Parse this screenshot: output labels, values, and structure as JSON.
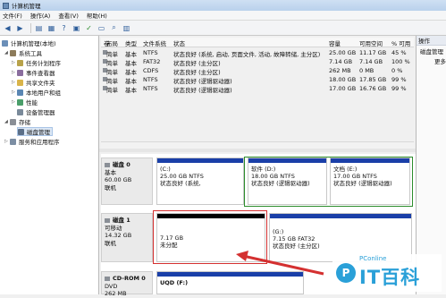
{
  "window": {
    "title": "计算机管理"
  },
  "menu": [
    "文件(F)",
    "操作(A)",
    "查看(V)",
    "帮助(H)"
  ],
  "toolbar_icons": [
    "back-icon",
    "forward-icon",
    "up-icon",
    "properties-icon",
    "help-icon",
    "connect-icon",
    "check-icon",
    "open-icon",
    "search-icon",
    "view-icon"
  ],
  "tree": {
    "root": "计算机管理(本地)",
    "system_tools": "系统工具",
    "task_scheduler": "任务计划程序",
    "event_viewer": "事件查看器",
    "shared_folders": "共享文件夹",
    "local_users": "本地用户和组",
    "performance": "性能",
    "device_manager": "设备管理器",
    "storage": "存储",
    "disk_management": "磁盘管理",
    "services": "服务和应用程序"
  },
  "volume_list": {
    "headers": [
      "卷",
      "布局",
      "类型",
      "文件系统",
      "状态",
      "容量",
      "可用空间",
      "% 可用"
    ],
    "rows": [
      [
        "",
        "简单",
        "基本",
        "NTFS",
        "状态良好 (系统, 启动, 页面文件, 活动, 故障转储, 主分区)",
        "25.00 GB",
        "11.17 GB",
        "45 %"
      ],
      [
        "",
        "简单",
        "基本",
        "FAT32",
        "状态良好 (主分区)",
        "7.14 GB",
        "7.14 GB",
        "100 %"
      ],
      [
        "",
        "简单",
        "基本",
        "CDFS",
        "状态良好 (主分区)",
        "262 MB",
        "0 MB",
        "0 %"
      ],
      [
        "",
        "简单",
        "基本",
        "NTFS",
        "状态良好 (逻辑驱动器)",
        "18.00 GB",
        "17.85 GB",
        "99 %"
      ],
      [
        "",
        "简单",
        "基本",
        "NTFS",
        "状态良好 (逻辑驱动器)",
        "17.00 GB",
        "16.76 GB",
        "99 %"
      ]
    ]
  },
  "actions": {
    "header": "操作",
    "item1": "磁盘管理",
    "item2": "更多"
  },
  "disks": [
    {
      "name": "磁盘 0",
      "type": "基本",
      "size": "60.00 GB",
      "status": "联机",
      "partitions": [
        {
          "label": "(C:)",
          "size": "25.00 GB NTFS",
          "status": "状态良好 (系统,"
        },
        {
          "label": "软件 (D:)",
          "size": "18.00 GB NTFS",
          "status": "状态良好 (逻辑驱动器)"
        },
        {
          "label": "文档 (E:)",
          "size": "17.00 GB NTFS",
          "status": "状态良好 (逻辑驱动器)"
        }
      ]
    },
    {
      "name": "磁盘 1",
      "type": "可移动",
      "size": "14.32 GB",
      "status": "联机",
      "partitions": [
        {
          "label": "",
          "size": "7.17 GB",
          "status": "未分配"
        },
        {
          "label": "(G:)",
          "size": "7.15 GB FAT32",
          "status": "状态良好 (主分区)"
        }
      ]
    },
    {
      "name": "CD-ROM 0",
      "type": "DVD",
      "size": "262 MB",
      "status": "",
      "partitions": [
        {
          "label": "UQD (F:)",
          "size": "",
          "status": ""
        }
      ]
    }
  ],
  "watermark": {
    "pc": "PConline",
    "brand": "IT百科",
    "logo": "P"
  }
}
